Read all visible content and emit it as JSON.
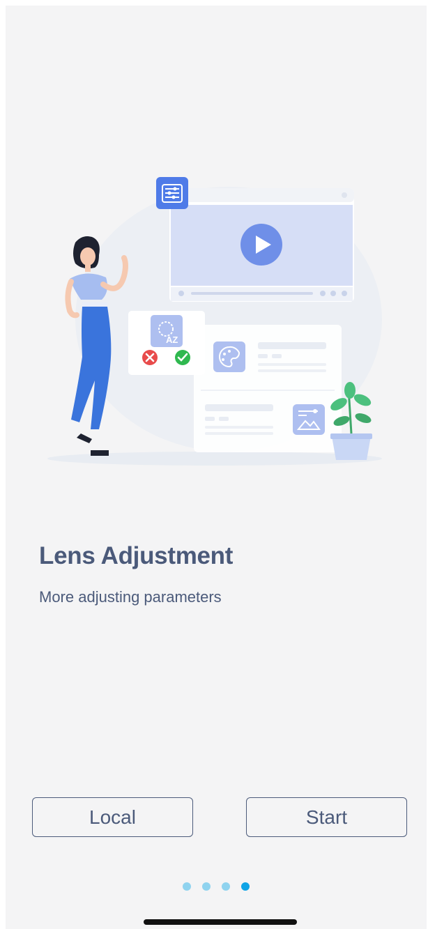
{
  "onboarding": {
    "title": "Lens Adjustment",
    "subtitle": "More adjusting parameters"
  },
  "buttons": {
    "local_label": "Local",
    "start_label": "Start"
  },
  "pagination": {
    "total_pages": 4,
    "active_page": 4
  },
  "colors": {
    "background": "#f4f4f5",
    "text": "#4b5a7a",
    "accent_blue": "#4f7be8",
    "dot_inactive": "#8fd3ef",
    "dot_active": "#0fa4e6"
  },
  "icons": {
    "illustration": "onboarding-illustration",
    "settings": "sliders-icon",
    "video": "play-icon",
    "translate": "translate-icon",
    "reject": "close-icon",
    "accept": "check-icon",
    "palette": "palette-icon",
    "image": "image-adjust-icon"
  }
}
